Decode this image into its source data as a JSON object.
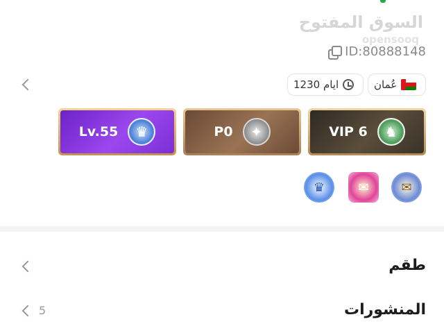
{
  "brand": {
    "arabic": "السوق المفتوح",
    "latin": "opensooq"
  },
  "profile": {
    "id_text": "ID:80888148",
    "country": "عُمان",
    "membership_days": "1230 ايام"
  },
  "badges": [
    {
      "label": "Lv.55",
      "emblem_icon": "crown-wings-icon"
    },
    {
      "label": "P0",
      "emblem_icon": "winged-shield-icon"
    },
    {
      "label": "VIP 6",
      "emblem_icon": "lion-shield-icon"
    }
  ],
  "achievements": [
    {
      "icon": "crowned-medal-icon"
    },
    {
      "icon": "gift-box-icon"
    },
    {
      "icon": "envelope-crest-icon"
    }
  ],
  "sections": [
    {
      "label": "طقم",
      "count": ""
    },
    {
      "label": "المنشورات",
      "count": "5"
    }
  ],
  "colors": {
    "level_badge": "#9b47ee",
    "points_badge": "#9a7354",
    "vip_badge": "#5a4d3b",
    "divider": "#f4f4f4"
  }
}
